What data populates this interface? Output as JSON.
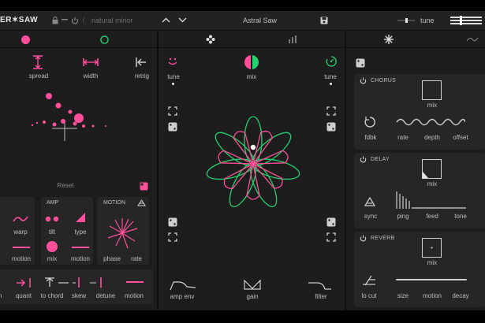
{
  "header": {
    "logo": "ER✶SAW",
    "preset_category": "natural minor",
    "preset_name": "Astral Saw",
    "macro_label": "tune"
  },
  "left": {
    "top_controls": [
      {
        "label": "spread",
        "icon": "spread-icon"
      },
      {
        "label": "width",
        "icon": "width-icon"
      },
      {
        "label": "retrig",
        "icon": "retrig-icon"
      }
    ],
    "reset_label": "Reset",
    "row1": {
      "warp": "warp",
      "amp_title": "AMP",
      "tilt": "tilt",
      "type": "type",
      "motion_title": "MOTION"
    },
    "row2": {
      "motion": "motion",
      "mix": "mix",
      "motion2": "motion",
      "phase": "phase",
      "rate": "rate"
    },
    "bottom": [
      "m",
      "quant",
      "to chord",
      "skew",
      "detune",
      "motion"
    ]
  },
  "center": {
    "left_tune": "tune",
    "mix": "mix",
    "right_tune": "tune",
    "bottom": [
      "amp env",
      "gain",
      "filter"
    ]
  },
  "right": {
    "chorus": {
      "title": "CHORUS",
      "mix": "mix",
      "params": [
        "fdbk",
        "rate",
        "depth",
        "offset"
      ]
    },
    "delay": {
      "title": "DELAY",
      "mix": "mix",
      "params": [
        "sync",
        "ping",
        "feed",
        "tone"
      ]
    },
    "reverb": {
      "title": "REVERB",
      "mix": "mix",
      "params": [
        "lo cut",
        "size",
        "motion",
        "decay"
      ]
    }
  },
  "colors": {
    "accent_pink": "#ff4f9a",
    "accent_green": "#25d16f",
    "background": "#1d1d1d"
  }
}
